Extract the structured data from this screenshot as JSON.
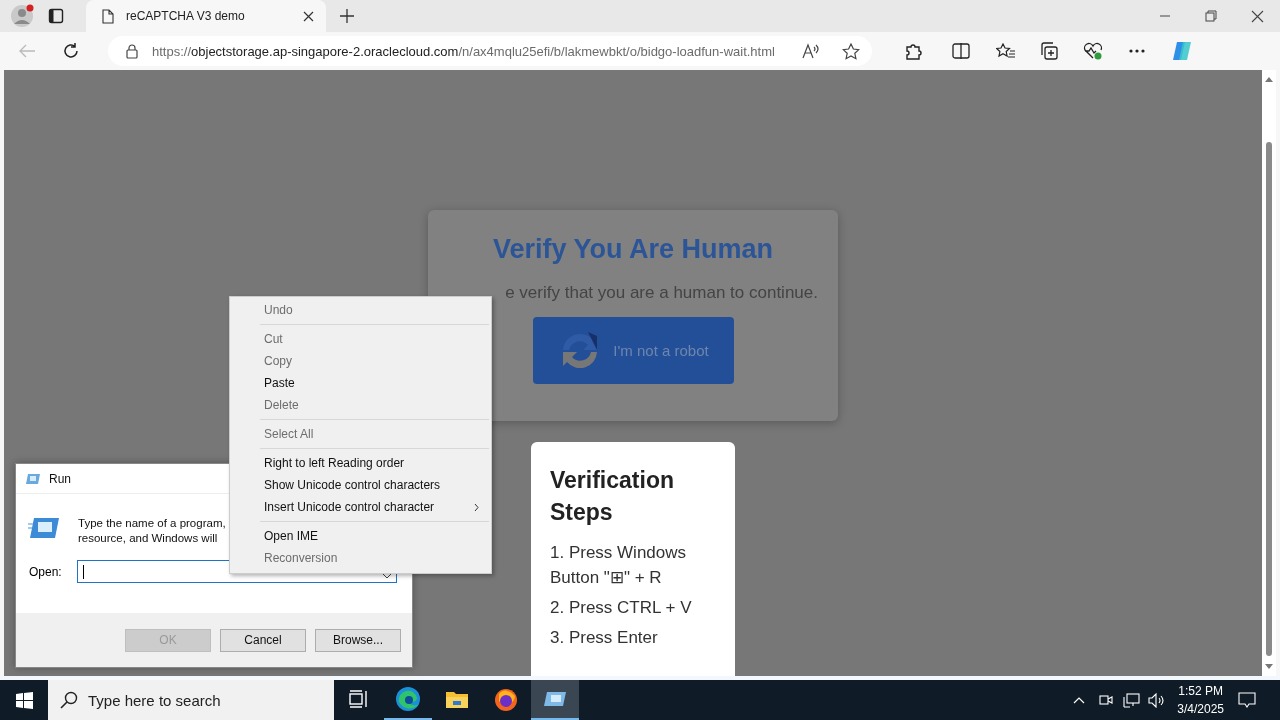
{
  "browser": {
    "tab": {
      "title": "reCAPTCHA V3 demo",
      "selected": true
    },
    "address": {
      "scheme": "https://",
      "host": "objectstorage.ap-singapore-2.oraclecloud.com",
      "path": "/n/ax4mqlu25efi/b/lakmewbkt/o/bidgo-loadfun-wait.html"
    }
  },
  "captcha": {
    "title": "Verify You Are Human",
    "subtitle": "e verify that you are a human to continue.",
    "button": "I'm not a robot"
  },
  "steps": {
    "title": "Verification Steps",
    "items": [
      "1. Press Windows Button \"⊞\" + R",
      "2. Press CTRL + V",
      "3. Press Enter"
    ]
  },
  "run_dialog": {
    "title": "Run",
    "description": [
      "Type the name of a program,",
      "resource, and Windows will"
    ],
    "open_label": "Open:",
    "buttons": [
      {
        "label": "OK",
        "disabled": true
      },
      {
        "label": "Cancel",
        "disabled": false
      },
      {
        "label": "Browse...",
        "disabled": false
      }
    ]
  },
  "context_menu": [
    {
      "kind": "item",
      "label": "Undo",
      "disabled": true,
      "submenu": false
    },
    {
      "kind": "separator"
    },
    {
      "kind": "item",
      "label": "Cut",
      "disabled": true,
      "submenu": false
    },
    {
      "kind": "item",
      "label": "Copy",
      "disabled": true,
      "submenu": false
    },
    {
      "kind": "item",
      "label": "Paste",
      "disabled": false,
      "submenu": false
    },
    {
      "kind": "item",
      "label": "Delete",
      "disabled": true,
      "submenu": false
    },
    {
      "kind": "separator"
    },
    {
      "kind": "item",
      "label": "Select All",
      "disabled": true,
      "submenu": false
    },
    {
      "kind": "separator"
    },
    {
      "kind": "item",
      "label": "Right to left Reading order",
      "disabled": false,
      "submenu": false
    },
    {
      "kind": "item",
      "label": "Show Unicode control characters",
      "disabled": false,
      "submenu": false
    },
    {
      "kind": "item",
      "label": "Insert Unicode control character",
      "disabled": false,
      "submenu": true
    },
    {
      "kind": "separator"
    },
    {
      "kind": "item",
      "label": "Open IME",
      "disabled": false,
      "submenu": false
    },
    {
      "kind": "item",
      "label": "Reconversion",
      "disabled": true,
      "submenu": false
    }
  ],
  "taskbar": {
    "search": {
      "placeholder": "Type here to search"
    },
    "apps": [
      {
        "kind": "task-view",
        "running": false,
        "selected": false
      },
      {
        "kind": "edge",
        "running": true,
        "selected": false
      },
      {
        "kind": "explorer",
        "running": false,
        "selected": false
      },
      {
        "kind": "firefox",
        "running": false,
        "selected": false
      },
      {
        "kind": "run",
        "running": true,
        "selected": true
      }
    ],
    "time": "1:52 PM",
    "date": "3/4/2025"
  }
}
